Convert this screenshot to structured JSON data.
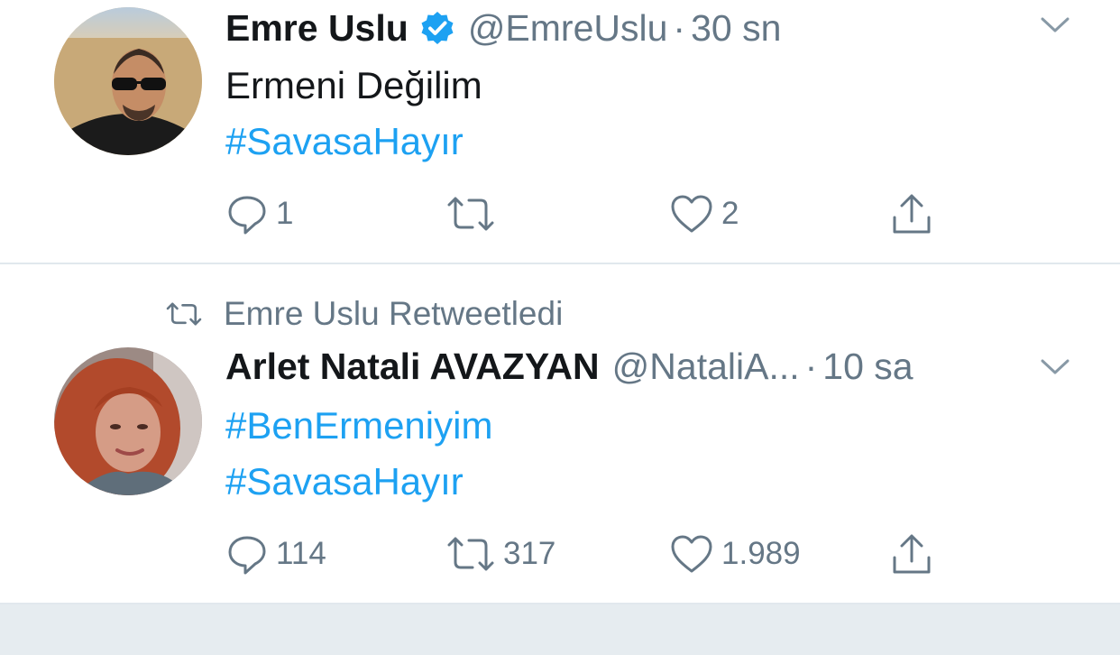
{
  "colors": {
    "link": "#1da1f2",
    "secondary": "#657786",
    "text": "#14171a",
    "verified": "#1da1f2"
  },
  "tweets": [
    {
      "author_name": "Emre Uslu",
      "verified": true,
      "handle": "@EmreUslu",
      "separator": "·",
      "time": "30 sn",
      "lines": [
        "Ermeni Değilim",
        "#SavasaHayır"
      ],
      "reply_count": "1",
      "retweet_count": "",
      "like_count": "2"
    },
    {
      "retweeted_by": "Emre Uslu Retweetledi",
      "author_name": "Arlet Natali AVAZYAN",
      "handle": "@NataliA...",
      "separator": "·",
      "time": "10 sa",
      "lines": [
        "#BenErmeniyim",
        "#SavasaHayır"
      ],
      "reply_count": "114",
      "retweet_count": "317",
      "like_count": "1.989"
    }
  ],
  "icons": [
    "reply-icon",
    "retweet-icon",
    "like-icon",
    "share-icon",
    "verified-badge-icon",
    "chevron-down-icon"
  ]
}
